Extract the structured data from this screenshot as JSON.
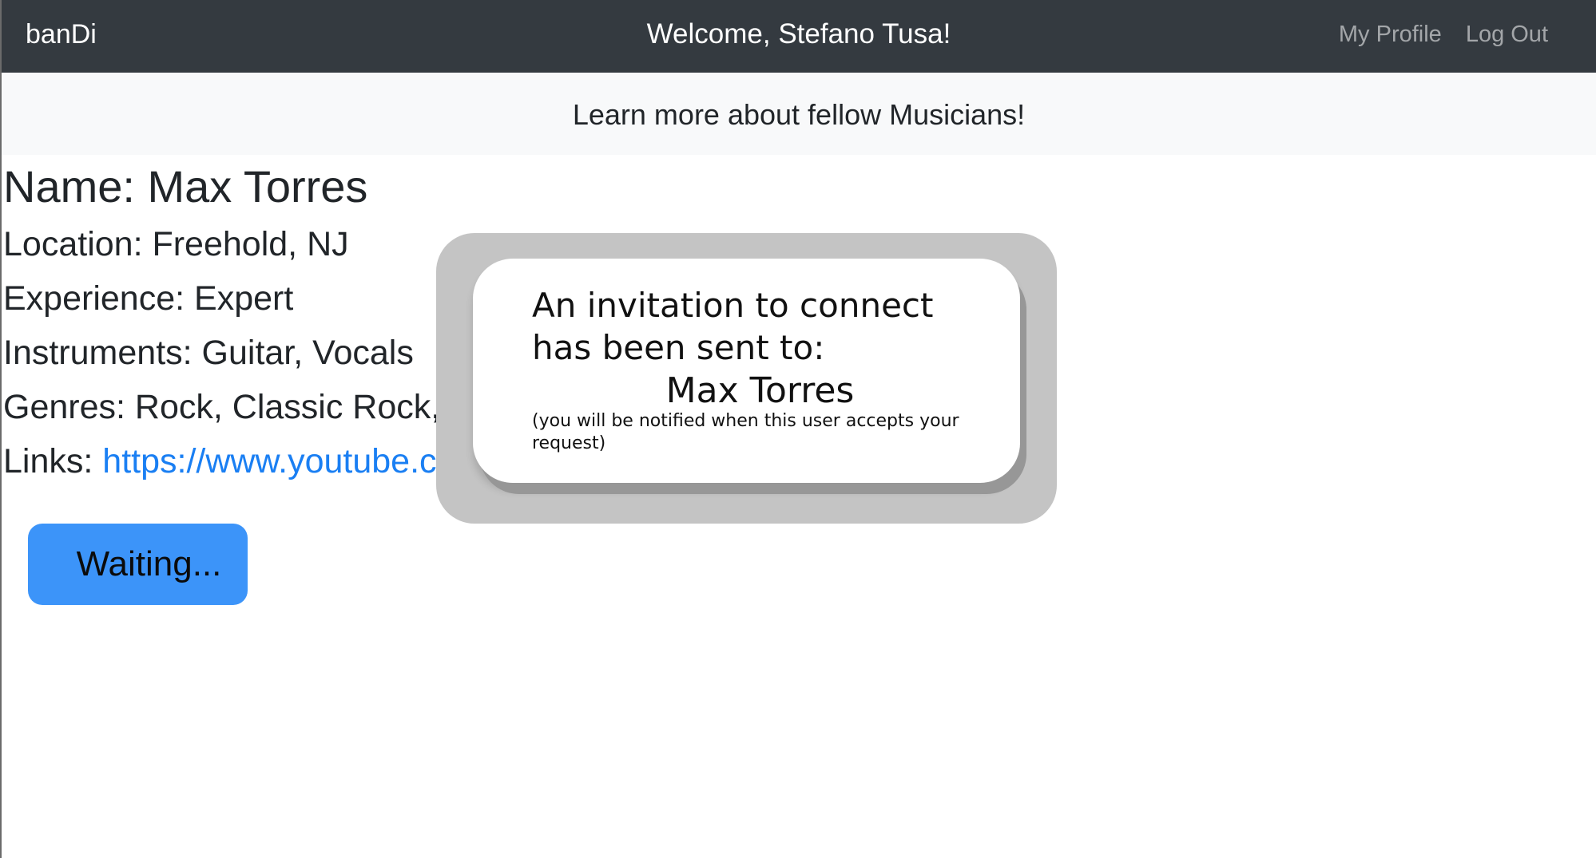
{
  "navbar": {
    "brand": "banDi",
    "welcome": "Welcome, Stefano Tusa!",
    "links": {
      "my_profile": "My Profile",
      "log_out": "Log Out"
    }
  },
  "subheader": {
    "text": "Learn more about fellow Musicians!"
  },
  "profile": {
    "name": "Name: Max Torres",
    "location": "Location: Freehold, NJ",
    "experience": "Experience: Expert",
    "instruments": "Instruments: Guitar, Vocals",
    "genres": "Genres: Rock, Classic Rock, E",
    "links_label": "Links: ",
    "links_value": "https://www.youtube.c"
  },
  "actions": {
    "waiting_label": "Waiting..."
  },
  "modal": {
    "message": "An invitation to connect has been sent to:",
    "recipient": "Max Torres",
    "note": "(you will be notified when this user accepts your request)"
  },
  "colors": {
    "navbar_bg": "#343a40",
    "subheader_bg": "#f8f9fa",
    "link": "#1a7ff3",
    "button": "#3c94f9",
    "modal_backdrop": "#c4c4c4"
  }
}
